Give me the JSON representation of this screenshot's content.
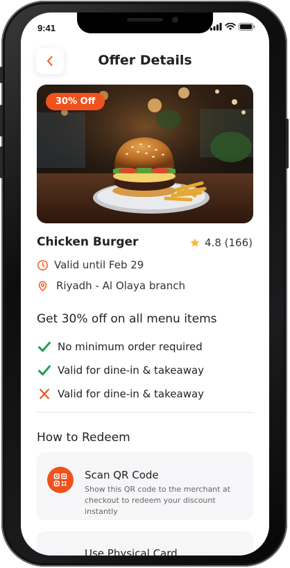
{
  "status_bar": {
    "time": "9:41"
  },
  "header": {
    "title": "Offer Details"
  },
  "offer": {
    "badge": "30% Off",
    "name": "Chicken Burger",
    "rating": "4.8 (166)",
    "valid_until": "Valid until Feb 29",
    "location": "Riyadh - Al Olaya branch"
  },
  "details": {
    "headline": "Get 30% off on all menu items",
    "items": [
      {
        "text": "No minimum order required",
        "status": "included"
      },
      {
        "text": "Valid for dine-in & takeaway",
        "status": "included"
      },
      {
        "text": "Valid for dine-in & takeaway",
        "status": "excluded"
      }
    ]
  },
  "redeem": {
    "title": "How to Redeem",
    "methods": [
      {
        "title": "Scan QR Code",
        "description": "Show this QR code to the merchant at checkout to redeem your discount instantly",
        "icon": "qr-code-icon"
      },
      {
        "title": "Use Physical Card",
        "description": "",
        "icon": "card-icon"
      }
    ]
  },
  "colors": {
    "accent": "#f0521d",
    "check": "#1e9e4a",
    "star": "#f6b93b",
    "text": "#222222"
  }
}
